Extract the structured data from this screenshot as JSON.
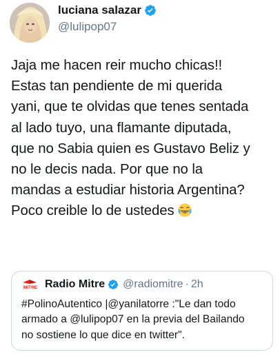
{
  "author": {
    "display_name": "luciana salazar",
    "handle": "@lulipop07",
    "verified_icon": "verified-badge-icon",
    "accent_color": "#1da1f2"
  },
  "tweet": {
    "text": "Jaja me hacen reir mucho chicas!!\nEstas tan pendiente de mi querida\nyani, que te olvidas que tenes sentada\nal lado tuyo, una flamante diputada,\nque no Sabia quien es Gustavo Beliz y\nno le decis nada. Por que no la\nmandas a estudiar historia Argentina?\nPoco creible lo de ustedes",
    "emoji": "face-with-tears-of-joy-icon"
  },
  "quote": {
    "source_logo": "radio-mitre-logo",
    "logo_text": "MITRE",
    "display_name": "Radio Mitre",
    "handle": "@radiomitre",
    "separator": "·",
    "time": "2h",
    "text": "#PolinoAutentico |@yanilatorre :\"Le dan todo\narmado a @lulipop07 en la previa del Bailando\nno sostiene lo que dice en twitter\"."
  }
}
